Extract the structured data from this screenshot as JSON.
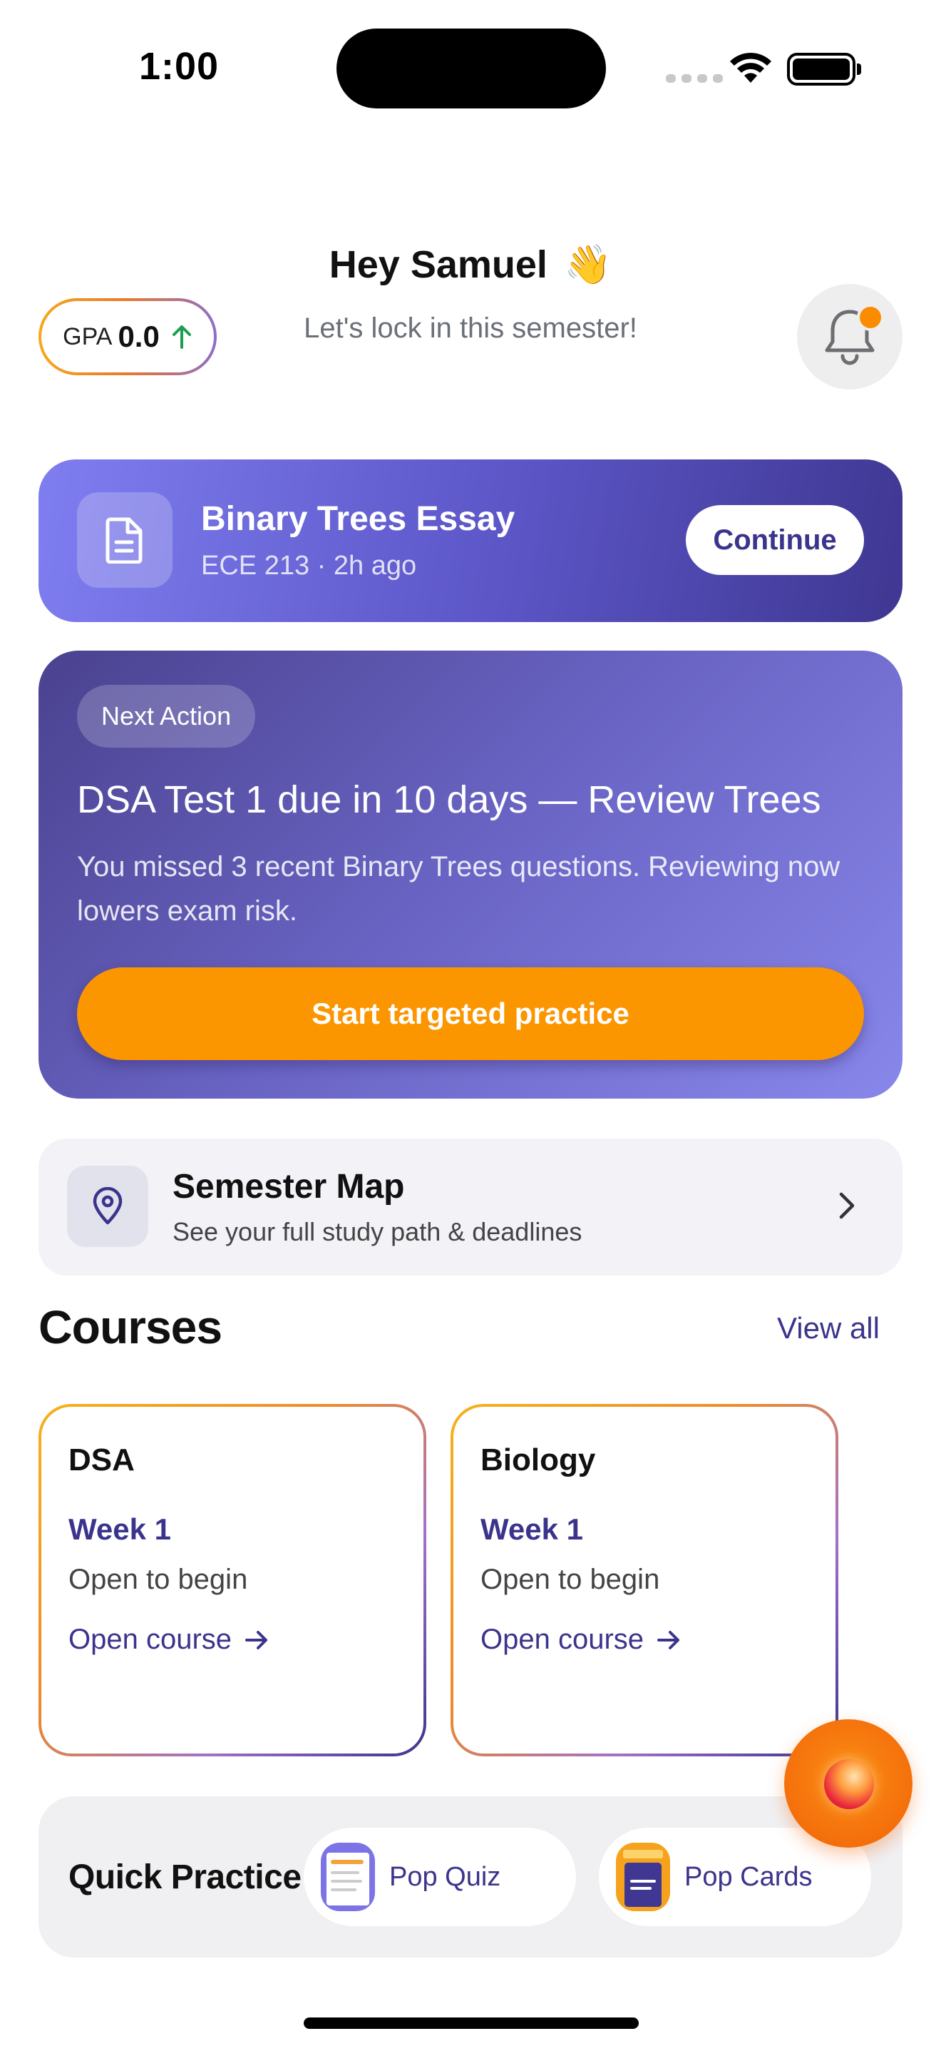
{
  "status_bar": {
    "time": "1:00"
  },
  "header": {
    "greeting": "Hey Samuel",
    "greeting_emoji": "👋",
    "subtitle": "Let's lock in this semester!",
    "gpa_label": "GPA",
    "gpa_value": "0.0",
    "gpa_trend_icon": "arrow-up-icon",
    "notification_badge": true
  },
  "continue_card": {
    "title": "Binary Trees Essay",
    "subtitle": "ECE 213 · 2h ago",
    "button_label": "Continue",
    "icon": "document-icon"
  },
  "next_action": {
    "badge": "Next Action",
    "title": "DSA Test 1 due in 10 days — Review Trees",
    "description": "You missed 3 recent Binary Trees questions. Reviewing now lowers exam risk.",
    "button_label": "Start targeted practice"
  },
  "semester_map": {
    "title": "Semester Map",
    "subtitle": "See your full study path & deadlines",
    "icon": "map-pin-icon"
  },
  "courses": {
    "title": "Courses",
    "view_all_label": "View all",
    "items": [
      {
        "name": "DSA",
        "week": "Week 1",
        "status": "Open to begin",
        "link": "Open course"
      },
      {
        "name": "Biology",
        "week": "Week 1",
        "status": "Open to begin",
        "link": "Open course"
      }
    ]
  },
  "quick_practice": {
    "title": "Quick Practice",
    "items": [
      {
        "label": "Pop Quiz",
        "icon": "pop-quiz-thumbnail"
      },
      {
        "label": "Pop Cards",
        "icon": "pop-cards-thumbnail"
      }
    ]
  },
  "colors": {
    "accent": "#3b348c",
    "orange": "#fb9500",
    "card_gradient_start": "#7f7ef0",
    "card_gradient_end": "#3f3791"
  }
}
